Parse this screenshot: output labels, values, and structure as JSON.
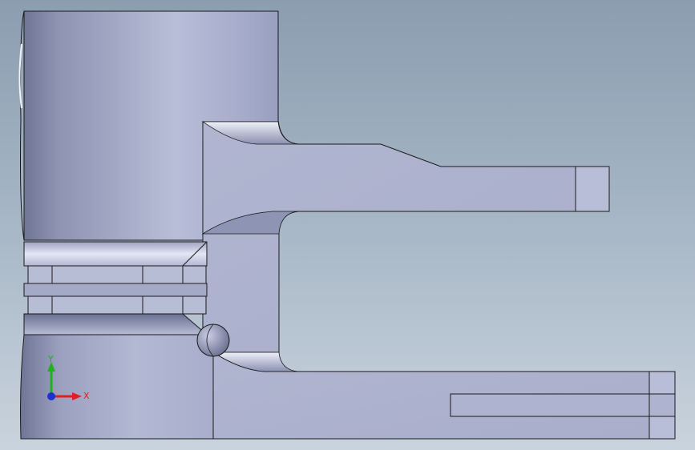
{
  "viewport": {
    "background_top": "#8b9db0",
    "background_bottom": "#c9d3dd"
  },
  "model": {
    "body_color": "#aeb4d0",
    "shade_color": "#7f86a6",
    "highlight_color": "#d7dbee",
    "edge_color": "#1a1a1a"
  },
  "triad": {
    "x_label": "X",
    "y_label": "Y",
    "x_color": "#e02020",
    "y_color": "#20b020",
    "z_color": "#2030d0"
  }
}
